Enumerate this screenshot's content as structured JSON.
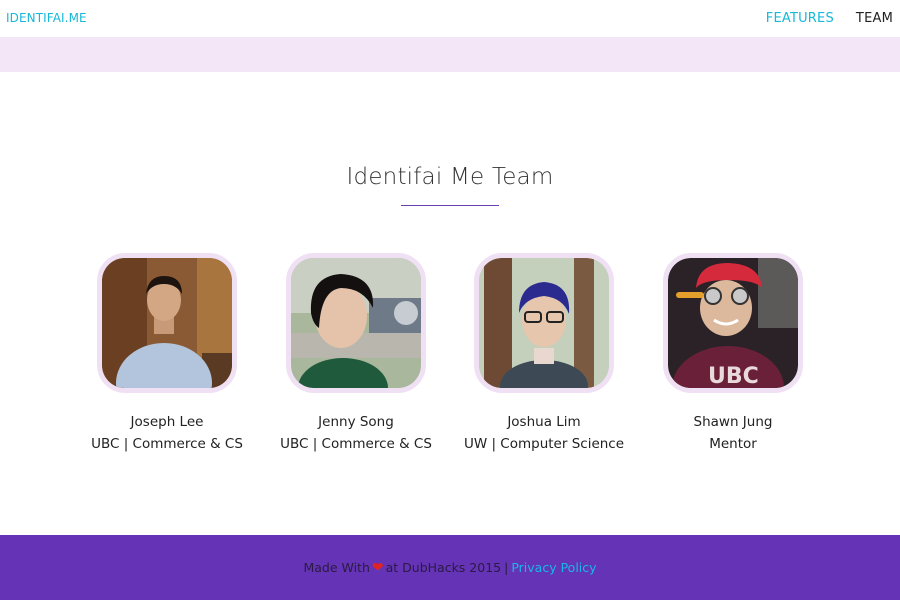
{
  "header": {
    "brand": "IDENTIFAI.ME",
    "nav": [
      {
        "label": "FEATURES"
      },
      {
        "label": "TEAM"
      }
    ]
  },
  "team_section": {
    "title": "Identifai Me Team",
    "members": [
      {
        "name": "Joseph Lee",
        "role": "UBC | Commerce & CS"
      },
      {
        "name": "Jenny Song",
        "role": "UBC | Commerce & CS"
      },
      {
        "name": "Joshua Lim",
        "role": "UW | Computer Science"
      },
      {
        "name": "Shawn Jung",
        "role": "Mentor"
      }
    ]
  },
  "footer": {
    "made_with": "Made With",
    "at_text": "at DubHacks 2015",
    "separator": "|",
    "privacy_link": "Privacy Policy"
  },
  "colors": {
    "accent": "#17b8d8",
    "band": "#f3e6f6",
    "footer_bg": "#6533b6",
    "rule": "#6a3fb4",
    "heart": "#e02424"
  }
}
